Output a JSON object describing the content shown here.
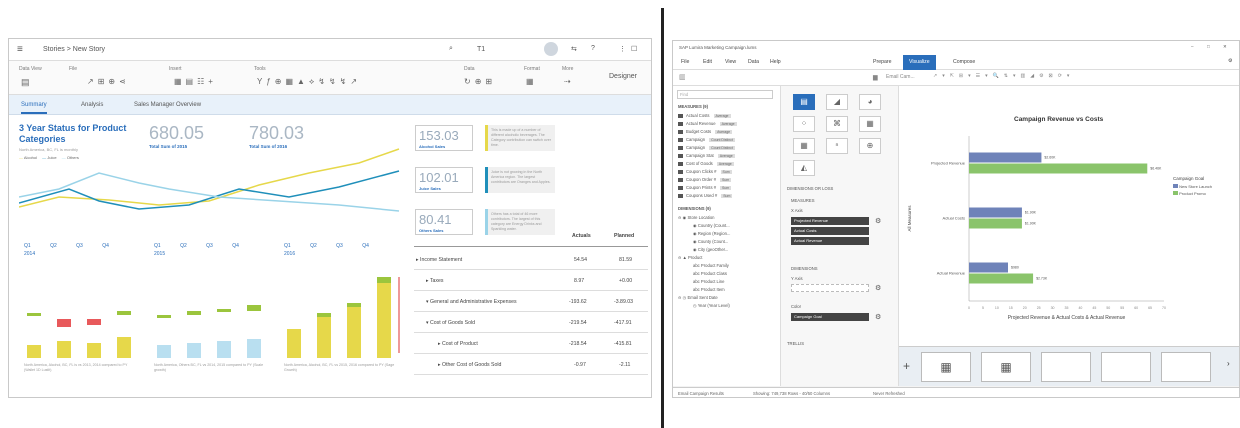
{
  "left": {
    "breadcrumb": "Stories > New Story",
    "page_indicator": "T1",
    "toolbar_groups": [
      "Data View",
      "File",
      "Insert",
      "Tools",
      "Data",
      "Format",
      "More"
    ],
    "designer_label": "Designer",
    "tabs": [
      "Summary",
      "Analysis",
      "Sales Manager Overview"
    ],
    "title": "3 Year Status for Product Categories",
    "subtitle": "North America, BC, FL is monthly",
    "legend": [
      "Alcohol",
      "Juice",
      "Others"
    ],
    "kpi_big": [
      {
        "value": "680.05",
        "label": "Total Sum of 2015"
      },
      {
        "value": "780.03",
        "label": "Total Sum of 2016"
      }
    ],
    "kpi_boxes": [
      {
        "value": "153.03",
        "label": "Alcohol Sales",
        "color": "#e6d84a",
        "note": "This is made up of a number of different alcoholic beverages. The Category contribution can switch over time."
      },
      {
        "value": "102.01",
        "label": "Juice Sales",
        "color": "#1f8fba",
        "note": "Juice is not growing in the North America region. The largest contributors are Oranges and Apples."
      },
      {
        "value": "80.41",
        "label": "Others Sales",
        "color": "#9ad3e8",
        "note": "Others has a total of 46 more contributors. The largest of this category are Energy Drinks and Sparkling water."
      }
    ],
    "quarter_groups": [
      {
        "year": "2014",
        "quarters": [
          "Q1",
          "Q2",
          "Q3",
          "Q4"
        ],
        "footer": "North America, Alcohol, BC, FL is vs 2013, 2014 compared to PY (Wallet 1D Lustlt)"
      },
      {
        "year": "2015",
        "quarters": [
          "Q1",
          "Q2",
          "Q3",
          "Q4"
        ],
        "footer": "North America, Others BC, FL vs 2014, 2015 compared to PY (Scale growth)"
      },
      {
        "year": "2016",
        "quarters": [
          "Q1",
          "Q2",
          "Q3",
          "Q4"
        ],
        "footer": "North America, Alcohol, BC, FL vs 2015, 2016 compared to PY (Sage Growth)"
      }
    ],
    "table": {
      "headers": [
        "Actuals",
        "Planned"
      ],
      "rows": [
        {
          "label": "Income Statement",
          "actual": "54.54",
          "planned": "81.59",
          "indent": 0
        },
        {
          "label": "Taxes",
          "actual": "8.97",
          "planned": "+0.00",
          "indent": 1
        },
        {
          "label": "General and Administrative Expenses",
          "actual": "-193.62",
          "planned": "-3.89.03",
          "indent": 1
        },
        {
          "label": "Cost of Goods Sold",
          "actual": "-219.54",
          "planned": "-417.91",
          "indent": 1
        },
        {
          "label": "Cost of Product",
          "actual": "-218.54",
          "planned": "-415.81",
          "indent": 2
        },
        {
          "label": "Other Cost of Goods Sold",
          "actual": "-0.97",
          "planned": "-2.11",
          "indent": 2
        }
      ]
    }
  },
  "right": {
    "window_title": "SAP Lumira Marketing Campaign.lums",
    "menu": [
      "File",
      "Edit",
      "View",
      "Data",
      "Help"
    ],
    "tabs": [
      "Prepare",
      "Visualize",
      "Compose"
    ],
    "dataset_label": "Email Cam...",
    "search_placeholder": "Find",
    "measures_header": "MEASURES (9)",
    "measures": [
      {
        "name": "Actual Costs",
        "tag": "Average"
      },
      {
        "name": "Actual Revenue",
        "tag": "Average"
      },
      {
        "name": "Budget Costs",
        "tag": "Average"
      },
      {
        "name": "Campaign",
        "tag": "Count Distinct"
      },
      {
        "name": "Campaign",
        "tag": "Count Distinct"
      },
      {
        "name": "Campaign Stat",
        "tag": "Average"
      },
      {
        "name": "Cost of Goods",
        "tag": "Average"
      },
      {
        "name": "Coupon Clicks #",
        "tag": "Sum"
      },
      {
        "name": "Coupon Order #",
        "tag": "Sum"
      },
      {
        "name": "Coupon Prints #",
        "tag": "Sum"
      },
      {
        "name": "Coupons Used #",
        "tag": "Sum"
      }
    ],
    "dimensions_header": "DIMENSIONS (9)",
    "dimensions": [
      "Store Location",
      "Country (Count...",
      "Region (Region...",
      "County (Count...",
      "City (geoOther...",
      "Product",
      "Product Family",
      "Product Class",
      "Product Line",
      "Product Item",
      "Email Sent Date",
      "Year (Year Level)"
    ],
    "builder": {
      "dims_header": "DIMENSIONS OR LOSS",
      "measures_header": "MEASURES",
      "xaxis_label": "X Axis",
      "xaxis_items": [
        "Projected Revenue",
        "Actual Costs",
        "Actual Revenue"
      ],
      "dims_label": "DIMENSIONS",
      "yaxis_label": "Y Axis",
      "color_label": "Color",
      "color_item": "Campaign Goal",
      "trellis_label": "TRELLIS"
    },
    "status": [
      "Email Campaign Results",
      "Showing: 749,738 Rows - 40/50 Columns",
      "Never Refreshed"
    ]
  },
  "chart_data": {
    "type": "bar",
    "orientation": "horizontal",
    "title": "Campaign Revenue vs Costs",
    "xlabel": "Projected Revenue & Actual Costs & Actual Revenue",
    "ylabel": "All Measures",
    "categories": [
      "Projected Revenue",
      "Actual Costs",
      "Actual Revenue"
    ],
    "legend_title": "Campaign Goal",
    "xlim": [
      0,
      70
    ],
    "xticks": [
      "0",
      "5",
      "10",
      "15",
      "20",
      "25",
      "30",
      "35",
      "40",
      "45",
      "50",
      "55",
      "60",
      "65",
      "70"
    ],
    "colors": [
      "#6f83b9",
      "#8ac46b"
    ],
    "series": [
      {
        "name": "New Store Launch",
        "values": [
          2.6,
          1.9,
          1.4
        ],
        "labels": [
          "$2.60K",
          "$1.90K",
          "$980"
        ]
      },
      {
        "name": "Product Promo",
        "values": [
          6.4,
          1.9,
          2.3
        ],
        "labels": [
          "$6.46K",
          "$1.90K",
          "$2.73K"
        ]
      }
    ]
  }
}
